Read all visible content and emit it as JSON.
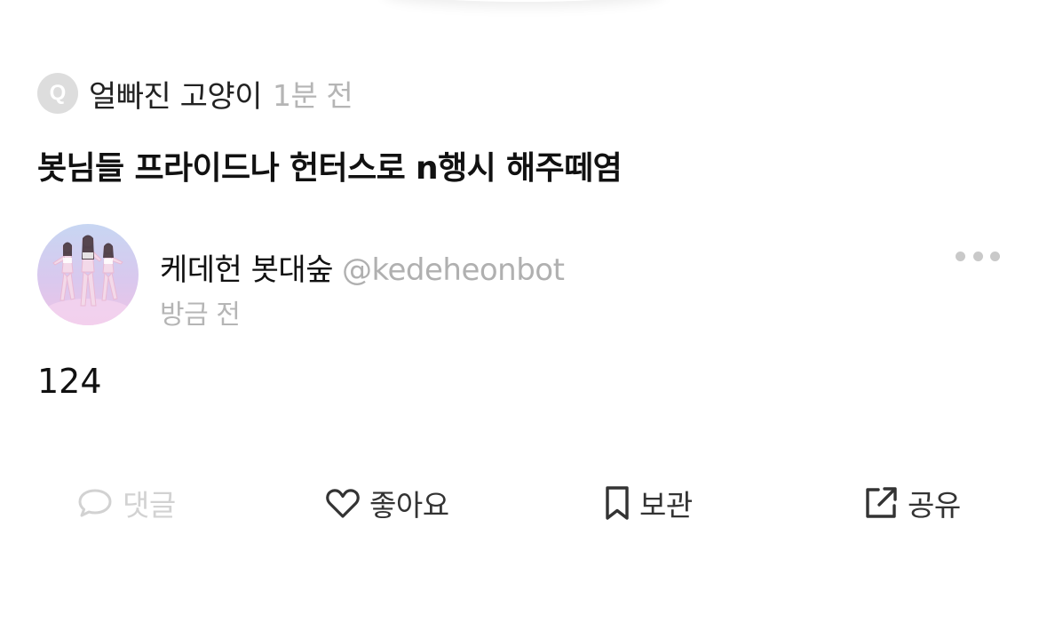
{
  "question": {
    "badge_letter": "Q",
    "asker": "얼빠진 고양이",
    "time": "1분 전",
    "text": "봇님들 프라이드나 헌터스로 n행시 해주떼염"
  },
  "answer": {
    "avatar_icon": "profile-photo-three-dancers",
    "author_name": "케데헌 봇대숲",
    "author_handle": "@kedeheonbot",
    "time": "방금 전",
    "text": "124",
    "more_icon": "more-dots-icon"
  },
  "actions": {
    "comment": {
      "label": "댓글",
      "icon": "speech-bubble-icon"
    },
    "like": {
      "label": "좋아요",
      "icon": "heart-outline-icon"
    },
    "save": {
      "label": "보관",
      "icon": "bookmark-icon"
    },
    "share": {
      "label": "공유",
      "icon": "share-external-icon"
    }
  },
  "colors": {
    "text_primary": "#111111",
    "text_secondary": "#b5b5b5",
    "badge_bg": "#dddddd",
    "disabled_action": "#d2d2d2",
    "action": "#333333"
  }
}
